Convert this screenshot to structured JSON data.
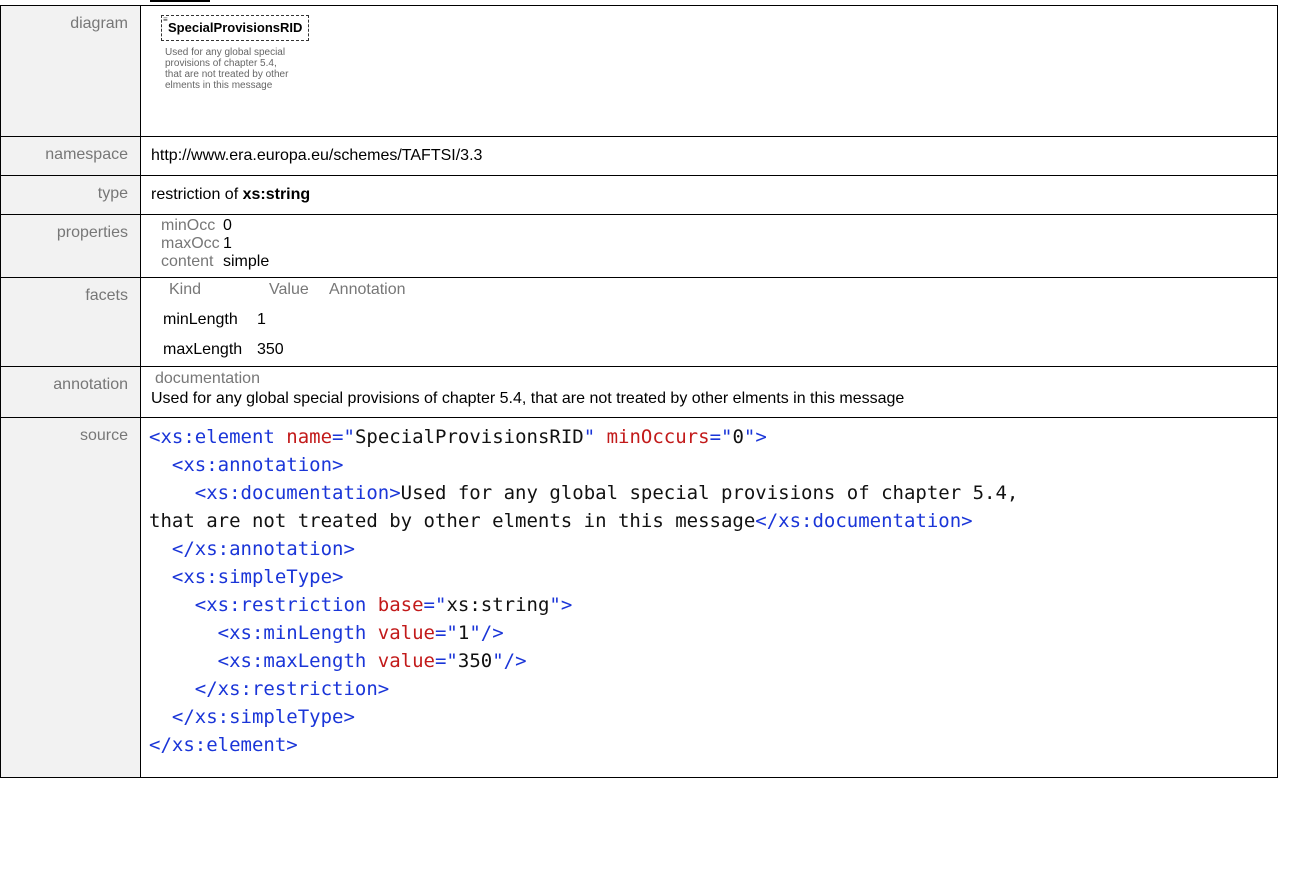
{
  "diagram": {
    "label": "diagram",
    "element_name": "SpecialProvisionsRID",
    "description": "Used for any global special provisions of chapter 5.4, that are not treated by other elments in this message"
  },
  "namespace": {
    "label": "namespace",
    "value": "http://www.era.europa.eu/schemes/TAFTSI/3.3"
  },
  "type": {
    "label": "type",
    "prefix": "restriction of ",
    "base": "xs:string"
  },
  "properties": {
    "label": "properties",
    "items": [
      {
        "key": "minOcc",
        "value": "0"
      },
      {
        "key": "maxOcc",
        "value": "1"
      },
      {
        "key": "content",
        "value": "simple"
      }
    ]
  },
  "facets": {
    "label": "facets",
    "headers": [
      "Kind",
      "Value",
      "Annotation"
    ],
    "rows": [
      {
        "kind": "minLength",
        "value": "1"
      },
      {
        "kind": "maxLength",
        "value": "350"
      }
    ]
  },
  "annotation": {
    "label": "annotation",
    "kind": "documentation",
    "text": "Used for any global special provisions of chapter 5.4, that are not treated by other elments in this message"
  },
  "source": {
    "label": "source",
    "lines": [
      [
        {
          "t": "tag",
          "v": "<xs:element "
        },
        {
          "t": "att",
          "v": "name"
        },
        {
          "t": "tag",
          "v": "=\""
        },
        {
          "t": "str",
          "v": "SpecialProvisionsRID"
        },
        {
          "t": "tag",
          "v": "\" "
        },
        {
          "t": "att",
          "v": "minOccurs"
        },
        {
          "t": "tag",
          "v": "=\""
        },
        {
          "t": "str",
          "v": "0"
        },
        {
          "t": "tag",
          "v": "\">"
        }
      ],
      [
        {
          "t": "tag",
          "v": "  <xs:annotation>"
        }
      ],
      [
        {
          "t": "tag",
          "v": "    <xs:documentation>"
        },
        {
          "t": "str",
          "v": "Used for any global special provisions of chapter 5.4,"
        }
      ],
      [
        {
          "t": "str",
          "v": "that are not treated by other elments in this message"
        },
        {
          "t": "tag",
          "v": "</xs:documentation>"
        }
      ],
      [
        {
          "t": "tag",
          "v": "  </xs:annotation>"
        }
      ],
      [
        {
          "t": "tag",
          "v": "  <xs:simpleType>"
        }
      ],
      [
        {
          "t": "tag",
          "v": "    <xs:restriction "
        },
        {
          "t": "att",
          "v": "base"
        },
        {
          "t": "tag",
          "v": "=\""
        },
        {
          "t": "str",
          "v": "xs:string"
        },
        {
          "t": "tag",
          "v": "\">"
        }
      ],
      [
        {
          "t": "tag",
          "v": "      <xs:minLength "
        },
        {
          "t": "att",
          "v": "value"
        },
        {
          "t": "tag",
          "v": "=\""
        },
        {
          "t": "str",
          "v": "1"
        },
        {
          "t": "tag",
          "v": "\"/>"
        }
      ],
      [
        {
          "t": "tag",
          "v": "      <xs:maxLength "
        },
        {
          "t": "att",
          "v": "value"
        },
        {
          "t": "tag",
          "v": "=\""
        },
        {
          "t": "str",
          "v": "350"
        },
        {
          "t": "tag",
          "v": "\"/>"
        }
      ],
      [
        {
          "t": "tag",
          "v": "    </xs:restriction>"
        }
      ],
      [
        {
          "t": "tag",
          "v": "  </xs:simpleType>"
        }
      ],
      [
        {
          "t": "tag",
          "v": "</xs:element>"
        }
      ]
    ]
  }
}
